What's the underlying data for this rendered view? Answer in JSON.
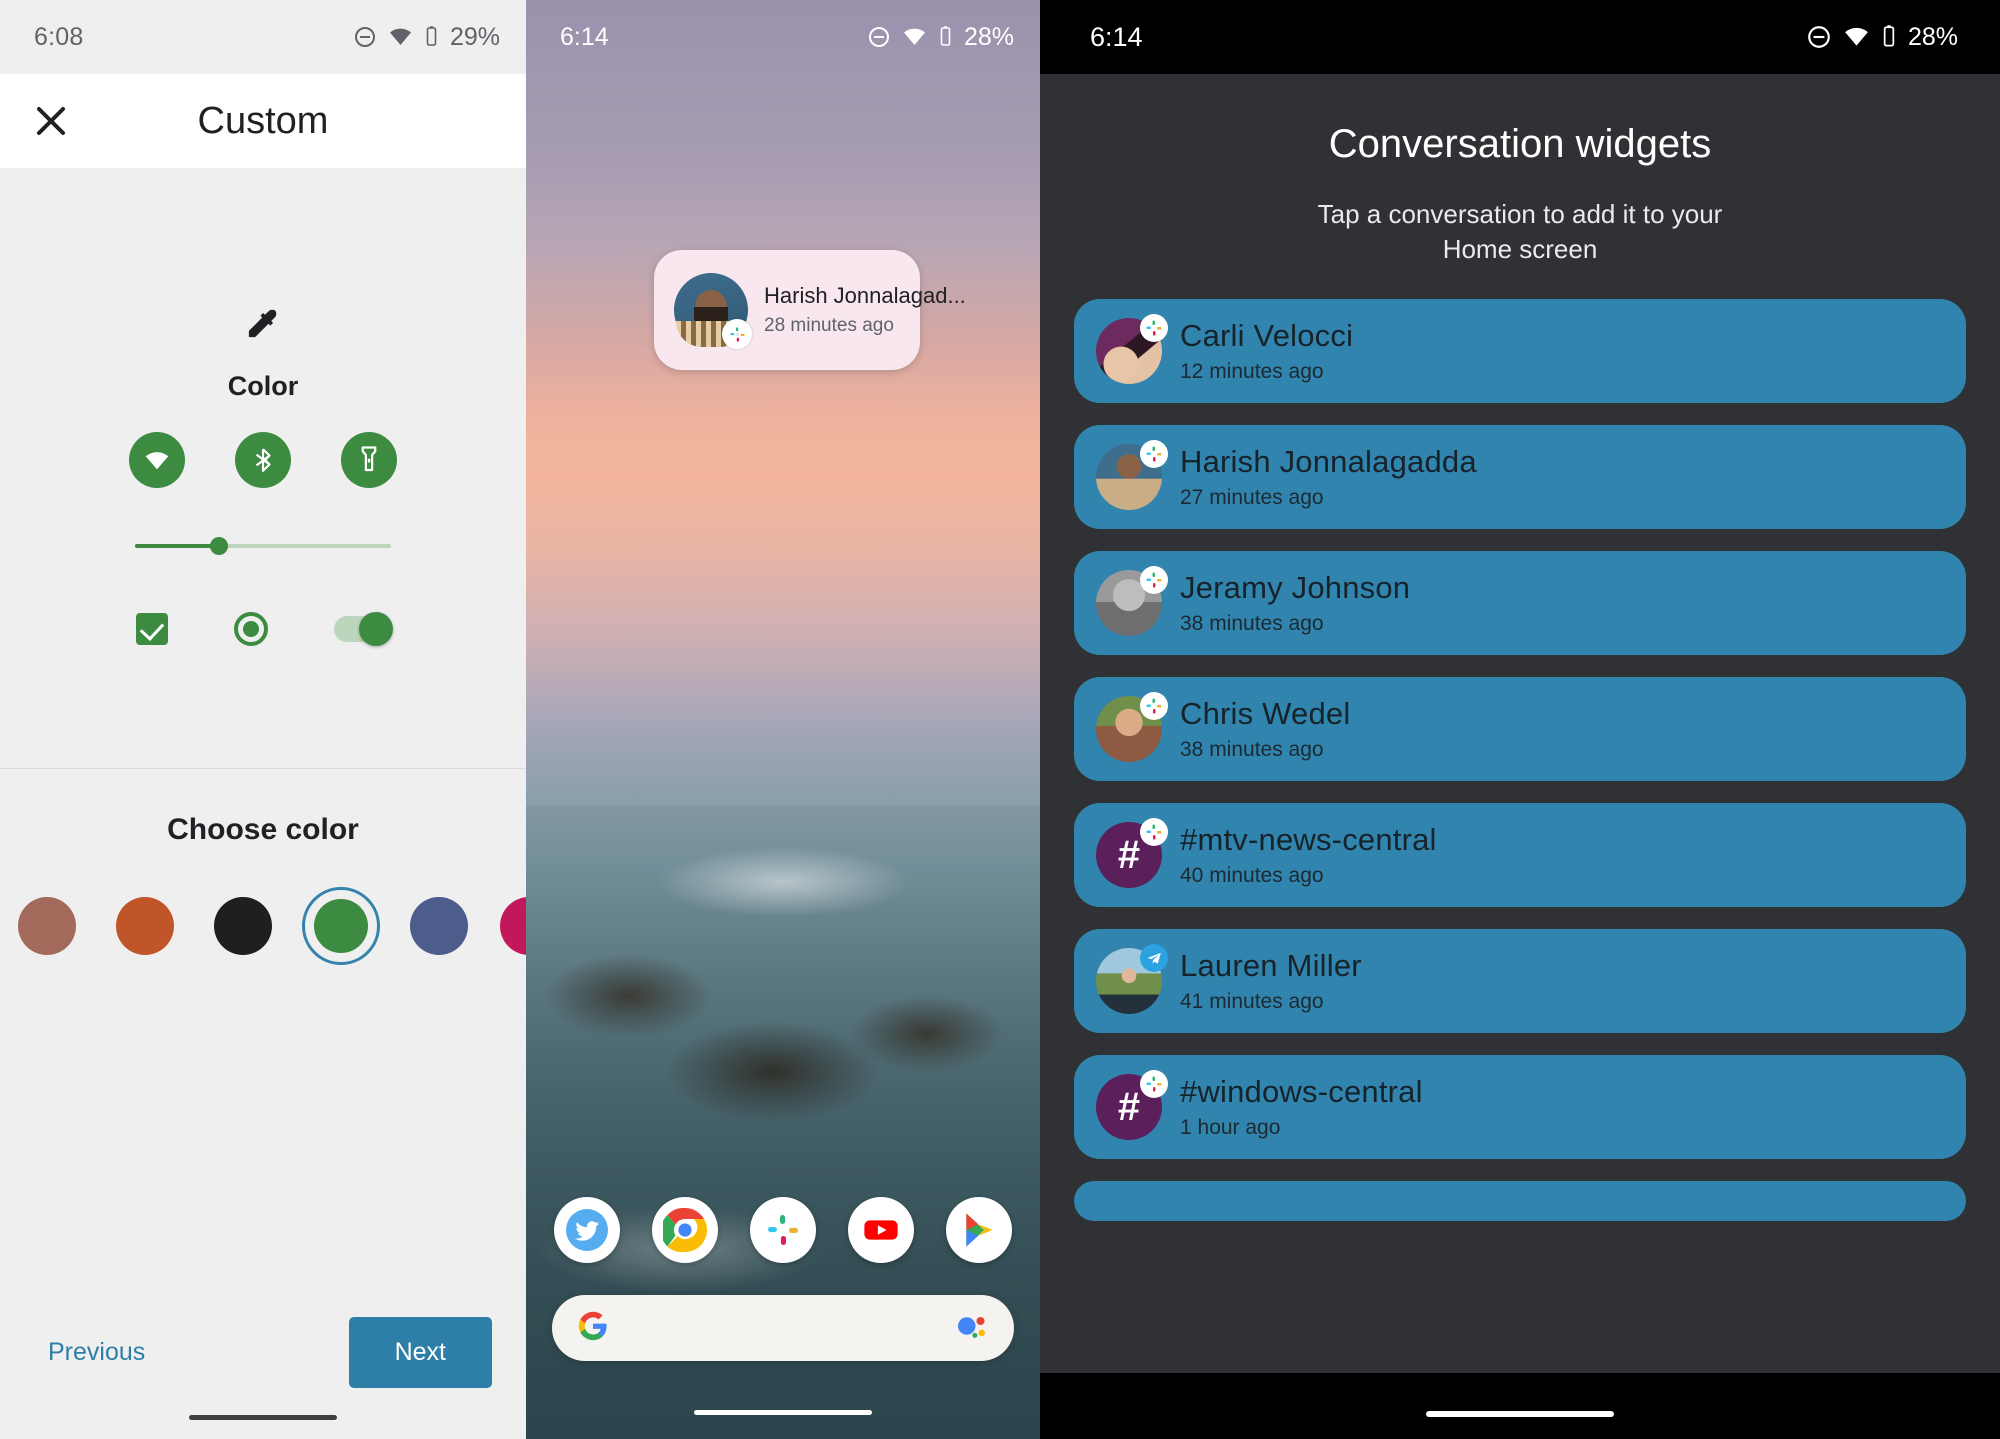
{
  "panel1": {
    "status": {
      "time": "6:08",
      "battery_pct": "29%",
      "icons": [
        "dnd-icon",
        "wifi-icon",
        "battery-icon"
      ]
    },
    "appbar": {
      "title": "Custom",
      "close_label": "Close"
    },
    "preview": {
      "eyedropper_icon": "eyedropper-icon",
      "color_label": "Color",
      "quick_settings": [
        "wifi-icon",
        "bluetooth-icon",
        "flashlight-icon"
      ],
      "slider_value_pct": 33,
      "controls": [
        "checkbox-checked",
        "radio-selected",
        "switch-on"
      ],
      "accent_color": "#3d8b40"
    },
    "chooser": {
      "title": "Choose color",
      "swatches": [
        {
          "name": "rose-brown",
          "hex": "#a3695b",
          "selected": false
        },
        {
          "name": "burnt-orange",
          "hex": "#c1552a",
          "selected": false
        },
        {
          "name": "near-black",
          "hex": "#1f1f1f",
          "selected": false
        },
        {
          "name": "green",
          "hex": "#3d8b40",
          "selected": true
        },
        {
          "name": "slate-blue",
          "hex": "#4c5d8c",
          "selected": false
        },
        {
          "name": "magenta",
          "hex": "#c2185b",
          "selected": false
        }
      ],
      "selection_ring_color": "#3383ac"
    },
    "footer": {
      "previous_label": "Previous",
      "next_label": "Next",
      "next_color": "#2e7fa8"
    }
  },
  "panel2": {
    "status": {
      "time": "6:14",
      "battery_pct": "28%",
      "icons": [
        "dnd-icon",
        "wifi-icon",
        "battery-icon"
      ]
    },
    "widget": {
      "name": "Harish Jonnalagad...",
      "time": "28 minutes ago",
      "app_badge": "slack-icon",
      "background": "#f8e7ef"
    },
    "dock": [
      {
        "name": "twitter-icon",
        "label": "Twitter"
      },
      {
        "name": "chrome-icon",
        "label": "Chrome"
      },
      {
        "name": "slack-icon",
        "label": "Slack"
      },
      {
        "name": "youtube-icon",
        "label": "YouTube"
      },
      {
        "name": "play-store-icon",
        "label": "Play Store"
      }
    ],
    "search": {
      "logo": "google-g-icon",
      "assistant": "assistant-icon",
      "placeholder": ""
    }
  },
  "panel3": {
    "status": {
      "time": "6:14",
      "battery_pct": "28%",
      "icons": [
        "dnd-icon",
        "wifi-icon",
        "battery-icon"
      ]
    },
    "title": "Conversation widgets",
    "subtitle": "Tap a conversation to add it to your Home screen",
    "card_color": "#3184ad",
    "conversations": [
      {
        "name": "Carli Velocci",
        "time": "12 minutes ago",
        "badge": "slack-icon",
        "avatar": "photo"
      },
      {
        "name": "Harish Jonnalagadda",
        "time": "27 minutes ago",
        "badge": "slack-icon",
        "avatar": "photo"
      },
      {
        "name": "Jeramy Johnson",
        "time": "38 minutes ago",
        "badge": "slack-icon",
        "avatar": "photo"
      },
      {
        "name": "Chris Wedel",
        "time": "38 minutes ago",
        "badge": "slack-icon",
        "avatar": "photo"
      },
      {
        "name": "#mtv-news-central",
        "time": "40 minutes ago",
        "badge": "slack-icon",
        "avatar": "hash"
      },
      {
        "name": "Lauren Miller",
        "time": "41 minutes ago",
        "badge": "telegram-icon",
        "avatar": "photo"
      },
      {
        "name": "#windows-central",
        "time": "1 hour ago",
        "badge": "slack-icon",
        "avatar": "hash"
      }
    ]
  }
}
